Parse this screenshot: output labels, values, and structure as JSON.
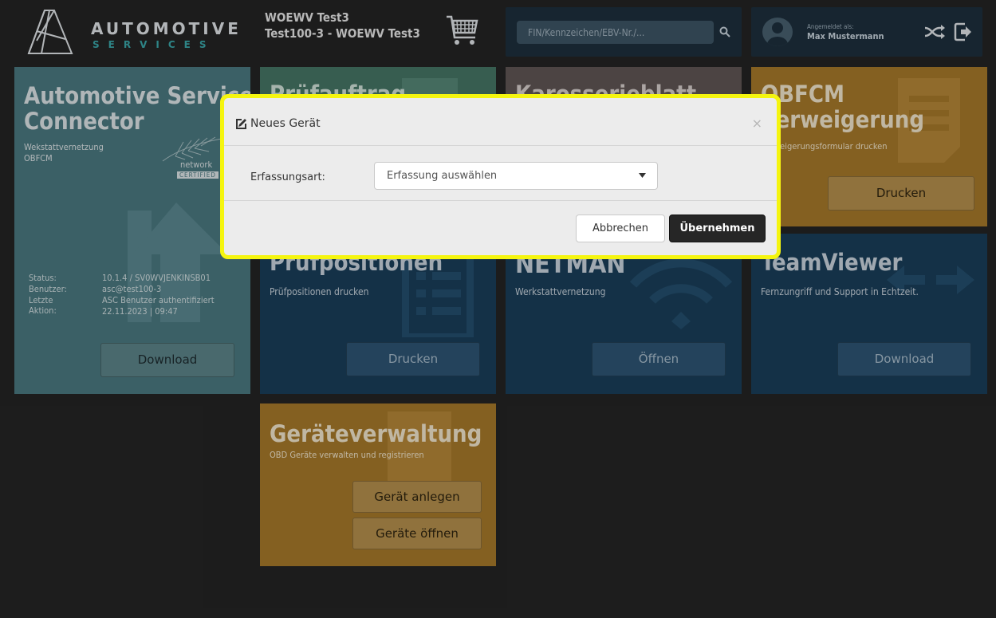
{
  "header": {
    "logo": {
      "word1": "AUTOMOTIVE",
      "word2": "SERVICES"
    },
    "case": {
      "line1": "WOEWV Test3",
      "line2": "Test100-3 - WOEWV Test3"
    },
    "search": {
      "placeholder": "FIN/Kennzeichen/EBV-Nr./..."
    },
    "user": {
      "label": "Angemeldet als:",
      "name": "Max Mustermann"
    }
  },
  "tiles": {
    "asc": {
      "title_line1": "Automotive Services",
      "title_line2": "Connector",
      "sub1": "Wekstattvernetzung",
      "sub2": "OBFCM",
      "badge_top": "network",
      "badge_bottom": "CERTIFIED",
      "status": [
        {
          "label": "Status:",
          "value": "10.1.4 / SV0WVJENKINSB01"
        },
        {
          "label": "Benutzer:",
          "value": "asc@test100-3"
        },
        {
          "label": "Letzte Aktion:",
          "value": "ASC Benutzer authentifiziert"
        },
        {
          "label": "",
          "value": "22.11.2023 | 09:47"
        }
      ],
      "button": "Download"
    },
    "pruefauftrag": {
      "title": "Prüfauftrag"
    },
    "karosserieblatt": {
      "title": "Karosserieblatt"
    },
    "obfcm": {
      "title_line1": "OBFCM",
      "title_line2": "Verweigerung",
      "sub": "Verweigerungsformular drucken",
      "button": "Drucken"
    },
    "pruefpositionen": {
      "title": "Prüfpositionen",
      "sub": "Prüfpositionen drucken",
      "button": "Drucken"
    },
    "netman": {
      "title": "NETMAN",
      "sub": "Werkstattvernetzung",
      "button": "Öffnen"
    },
    "teamviewer": {
      "title": "TeamViewer",
      "sub": "Fernzungriff und Support in Echtzeit.",
      "button": "Download"
    },
    "geraeteverwaltung": {
      "title": "Geräteverwaltung",
      "sub": "OBD Geräte verwalten und registrieren",
      "button1": "Gerät anlegen",
      "button2": "Geräte öffnen"
    }
  },
  "modal": {
    "title": "Neues Gerät",
    "close": "×",
    "field_label": "Erfassungsart:",
    "select_value": "Erfassung auswählen",
    "cancel": "Abbrechen",
    "confirm": "Übernehmen"
  },
  "colors": {
    "highlight": "#f5f50f",
    "tile_asc": "#4a7880",
    "tile_orange": "#a6792a",
    "tile_blue": "#1a3e59",
    "tile_green": "#457565",
    "tile_brown": "#605654"
  },
  "icons": [
    "logo-mark-icon",
    "cart-icon",
    "search-icon",
    "avatar-icon",
    "shuffle-icon",
    "logout-icon",
    "edit-icon",
    "chevron-down-icon",
    "wifi-icon",
    "arrow-up-icon",
    "document-icon",
    "list-icon",
    "arrows-icon"
  ]
}
